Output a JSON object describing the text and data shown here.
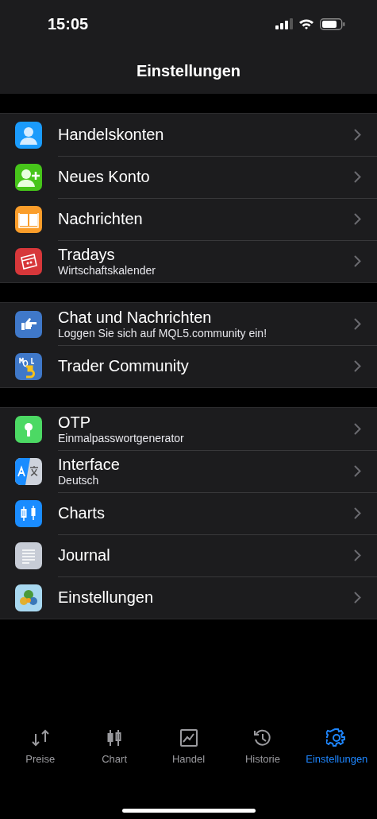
{
  "status_bar": {
    "time": "15:05"
  },
  "header": {
    "title": "Einstellungen"
  },
  "groups": [
    {
      "items": [
        {
          "title": "Handelskonten"
        },
        {
          "title": "Neues Konto"
        },
        {
          "title": "Nachrichten"
        },
        {
          "title": "Tradays",
          "subtitle": "Wirtschaftskalender"
        }
      ]
    },
    {
      "items": [
        {
          "title": "Chat und Nachrichten",
          "subtitle": "Loggen Sie sich auf MQL5.community ein!"
        },
        {
          "title": "Trader Community"
        }
      ]
    },
    {
      "items": [
        {
          "title": "OTP",
          "subtitle": "Einmalpasswortgenerator"
        },
        {
          "title": "Interface",
          "subtitle": "Deutsch"
        },
        {
          "title": "Charts"
        },
        {
          "title": "Journal"
        },
        {
          "title": "Einstellungen"
        }
      ]
    }
  ],
  "tab_bar": [
    {
      "label": "Preise",
      "selected": false
    },
    {
      "label": "Chart",
      "selected": false
    },
    {
      "label": "Handel",
      "selected": false
    },
    {
      "label": "Historie",
      "selected": false
    },
    {
      "label": "Einstellungen",
      "selected": true
    }
  ]
}
